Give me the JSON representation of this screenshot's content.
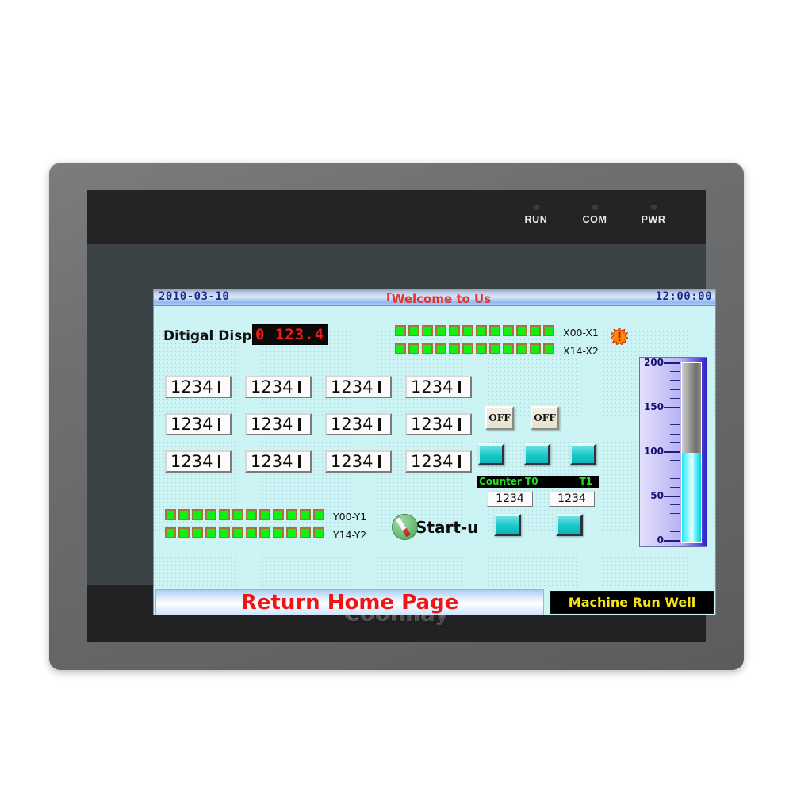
{
  "device": {
    "brand": "Coolmay",
    "status_leds": [
      {
        "label": "RUN",
        "icon": "led-indicator-icon"
      },
      {
        "label": "COM",
        "icon": "led-indicator-icon"
      },
      {
        "label": "PWR",
        "icon": "led-indicator-icon"
      }
    ]
  },
  "screen": {
    "titlebar": {
      "date": "2010-03-10",
      "time": "12:00:00",
      "title": "「Welcome to Us"
    },
    "digital_display": {
      "label": "Ditigal Displ",
      "value": "0 123.4"
    },
    "input_leds": {
      "rows": [
        {
          "label": "X00-X1",
          "count": 12,
          "state": "on"
        },
        {
          "label": "X14-X2",
          "count": 12,
          "state": "on"
        }
      ],
      "alarm_icon": "alarm-burst-icon"
    },
    "output_leds": {
      "rows": [
        {
          "label": "Y00-Y1",
          "count": 12,
          "state": "on"
        },
        {
          "label": "Y14-Y2",
          "count": 12,
          "state": "on"
        }
      ]
    },
    "numeric_grid": {
      "rows": [
        [
          "1234",
          "1234",
          "1234",
          "1234"
        ],
        [
          "1234",
          "1234",
          "1234",
          "1234"
        ],
        [
          "1234",
          "1234",
          "1234",
          "1234"
        ]
      ]
    },
    "toggle_buttons": [
      {
        "label": "OFF",
        "state": "off"
      },
      {
        "label": "OFF",
        "state": "off"
      }
    ],
    "action_buttons": [
      {
        "name": "cyan-button-1"
      },
      {
        "name": "cyan-button-2"
      },
      {
        "name": "cyan-button-3"
      },
      {
        "name": "cyan-button-4"
      },
      {
        "name": "cyan-button-5"
      }
    ],
    "counter_panel": {
      "label_t0": "Counter T0",
      "label_t1": "T1",
      "value_t0": "1234",
      "value_t1": "1234"
    },
    "startup": {
      "label": "Start-u",
      "icon": "rotary-switch-icon"
    },
    "gauge": {
      "unit_ticks": [
        "200",
        "150",
        "100",
        "50",
        "0"
      ],
      "min": 0,
      "max": 200,
      "value": 100,
      "fill_color": "#46ecf5"
    },
    "footer": {
      "home_label": "Return Home Page",
      "status_message": "Machine Run Well"
    }
  },
  "colors": {
    "screen_bg": "#ccf4f4",
    "led_on": "#12ef12",
    "accent_red": "#f01414",
    "accent_yellow": "#f5e316",
    "title_red": "#e8312a",
    "counter_green": "#24e024"
  }
}
